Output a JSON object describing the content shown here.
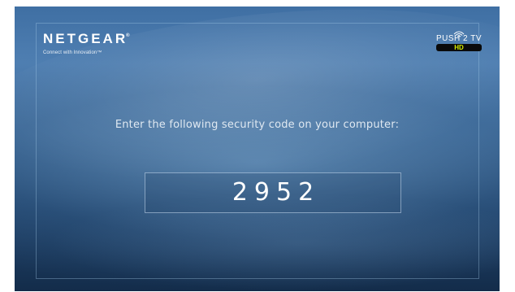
{
  "brand": {
    "name": "NETGEAR",
    "registered_mark": "®",
    "tagline": "Connect with Innovation™"
  },
  "product": {
    "name": "PUSH 2 TV",
    "badge": "HD"
  },
  "prompt": {
    "message": "Enter the following security code on your computer:"
  },
  "security_code": "2952",
  "icons": [
    "wifi-icon"
  ],
  "colors": {
    "background_top": "#4f7fb2",
    "background_bottom": "#132c4a",
    "text": "#ffffff",
    "hd_badge_text": "#d8f000"
  }
}
